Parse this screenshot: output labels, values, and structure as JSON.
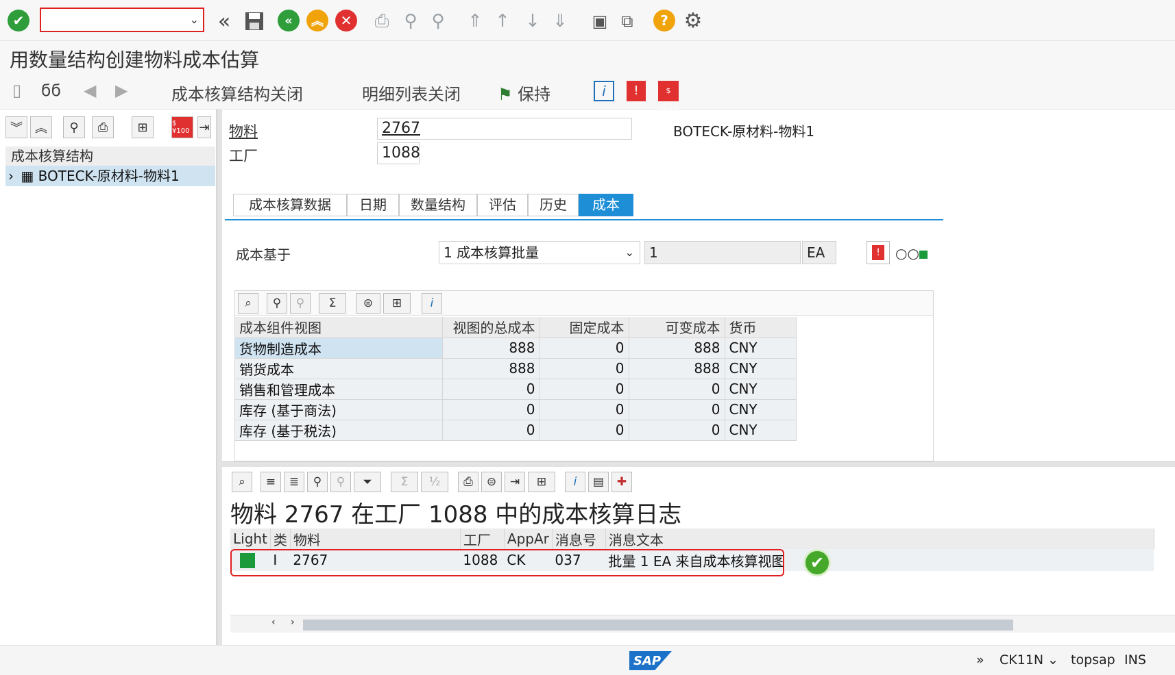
{
  "window": {
    "title": "用数量结构创建物料成本估算"
  },
  "system_toolbar": {
    "command_field_value": "",
    "icons": [
      "enter-icon",
      "back-double-icon",
      "save-icon",
      "back-icon",
      "exit-icon",
      "cancel-icon",
      "print-icon",
      "find-icon",
      "find-next-icon",
      "first-page-icon",
      "previous-page-icon",
      "next-page-icon",
      "last-page-icon",
      "create-session-icon",
      "shortcut-icon",
      "help-icon",
      "settings-icon"
    ]
  },
  "app_toolbar": {
    "btn_costing_structure_off": "成本核算结构关闭",
    "btn_detail_list_off": "明细列表关闭",
    "btn_keep": "保持"
  },
  "left_panel": {
    "header": "成本核算结构",
    "tree_item": "BOTECK-原材料-物料1"
  },
  "header": {
    "material_label": "物料",
    "material_value": "2767",
    "plant_label": "工厂",
    "plant_value": "1088",
    "material_description": "BOTECK-原材料-物料1"
  },
  "tabs": [
    {
      "label": "成本核算数据"
    },
    {
      "label": "日期"
    },
    {
      "label": "数量结构"
    },
    {
      "label": "评估"
    },
    {
      "label": "历史"
    },
    {
      "label": "成本"
    }
  ],
  "cost_basis": {
    "label": "成本基于",
    "selected": "1 成本核算批量",
    "quantity": "1",
    "unit": "EA"
  },
  "cost_grid": {
    "columns": [
      "成本组件视图",
      "视图的总成本",
      "固定成本",
      "可变成本",
      "货币"
    ],
    "rows": [
      [
        "货物制造成本",
        "888",
        "0",
        "888",
        "CNY"
      ],
      [
        "销货成本",
        "888",
        "0",
        "888",
        "CNY"
      ],
      [
        "销售和管理成本",
        "0",
        "0",
        "0",
        "CNY"
      ],
      [
        "库存 (基于商法)",
        "0",
        "0",
        "0",
        "CNY"
      ],
      [
        "库存 (基于税法)",
        "0",
        "0",
        "0",
        "CNY"
      ]
    ]
  },
  "log": {
    "title": "物料 2767 在工厂 1088 中的成本核算日志",
    "columns": [
      "Light",
      "类",
      "物料",
      "工厂",
      "AppAr",
      "消息号",
      "消息文本"
    ],
    "rows": [
      {
        "light": "green",
        "type": "I",
        "material": "2767",
        "plant": "1088",
        "area": "CK",
        "msg_no": "037",
        "text": "批量 1 EA 来自成本核算视图"
      }
    ]
  },
  "status_bar": {
    "logo": "SAP",
    "expand": "»",
    "transaction": "CK11N",
    "dropdown": "⌄",
    "server": "topsap",
    "mode": "INS"
  },
  "colors": {
    "accent_blue": "#1e8fd6",
    "success_green": "#45a82a",
    "error_red": "#e02020",
    "selected_row": "#cfe3f1"
  }
}
